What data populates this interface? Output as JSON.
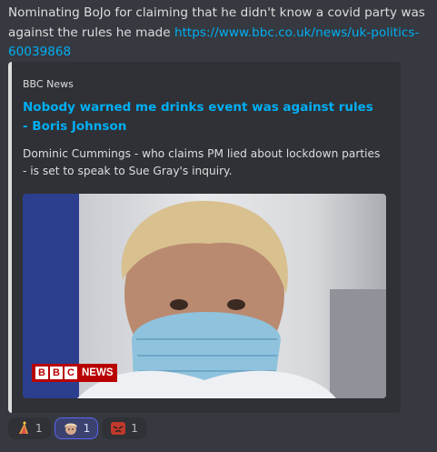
{
  "message": {
    "text": "Nominating BoJo for claiming that he didn't know a covid party was against the rules he made ",
    "link": "https://www.bbc.co.uk/news/uk-politics-60039868"
  },
  "embed": {
    "provider": "BBC News",
    "title": "Nobody warned me drinks event was against rules - Boris Johnson",
    "description": "Dominic Cummings - who claims PM lied about lockdown parties - is set to speak to Sue Gray's inquiry.",
    "image": {
      "badge_box_letters": [
        "B",
        "B",
        "C"
      ],
      "badge_text": "NEWS"
    }
  },
  "reactions": [
    {
      "emoji": "party-hat-icon",
      "count": "1"
    },
    {
      "emoji": "boris-face-icon",
      "count": "1"
    },
    {
      "emoji": "angry-face-icon",
      "count": "1"
    }
  ],
  "colors": {
    "background": "#36393f",
    "embed_bg": "#2f3136",
    "link": "#00aff4",
    "text": "#dcddde",
    "bbc_red": "#b80000",
    "reaction_active": "#5865f2"
  }
}
